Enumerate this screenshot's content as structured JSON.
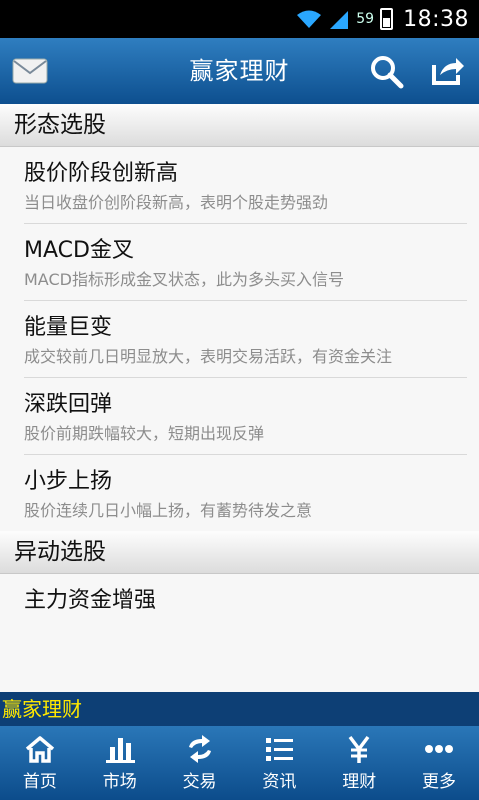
{
  "status_bar": {
    "battery_percent": "59",
    "time": "18:38"
  },
  "app_bar": {
    "title": "赢家理财"
  },
  "sections": [
    {
      "header": "形态选股",
      "items": [
        {
          "title": "股价阶段创新高",
          "desc": "当日收盘价创阶段新高，表明个股走势强劲"
        },
        {
          "title": "MACD金叉",
          "desc": "MACD指标形成金叉状态，此为多头买入信号"
        },
        {
          "title": "能量巨变",
          "desc": "成交较前几日明显放大，表明交易活跃，有资金关注"
        },
        {
          "title": "深跌回弹",
          "desc": "股价前期跌幅较大，短期出现反弹"
        },
        {
          "title": "小步上扬",
          "desc": "股价连续几日小幅上扬，有蓄势待发之意"
        }
      ]
    },
    {
      "header": "异动选股",
      "items": [
        {
          "title": "主力资金增强",
          "desc": ""
        }
      ]
    }
  ],
  "banner": {
    "text": "赢家理财"
  },
  "tabs": [
    {
      "label": "首页",
      "icon": "home-icon"
    },
    {
      "label": "市场",
      "icon": "bar-chart-icon"
    },
    {
      "label": "交易",
      "icon": "exchange-icon"
    },
    {
      "label": "资讯",
      "icon": "list-icon"
    },
    {
      "label": "理财",
      "icon": "yen-icon"
    },
    {
      "label": "更多",
      "icon": "more-icon"
    }
  ]
}
